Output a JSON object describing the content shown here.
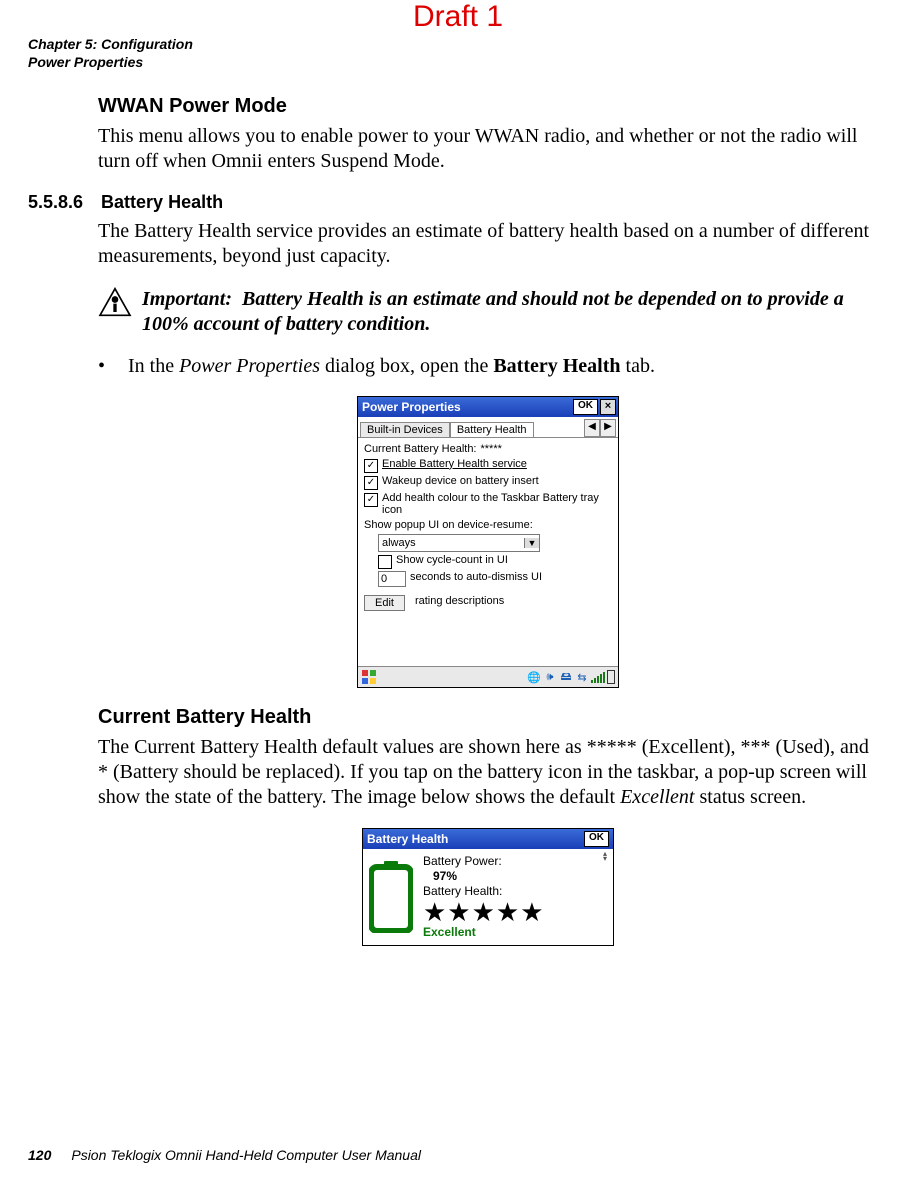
{
  "draft": "Draft 1",
  "header": {
    "chapter": "Chapter 5: Configuration",
    "section": "Power Properties"
  },
  "wwan": {
    "title": "WWAN Power Mode",
    "para": "This menu allows you to enable power to your WWAN radio, and whether or not the radio will turn off when Omnii enters Suspend Mode."
  },
  "battery_section": {
    "num": "5.5.8.6",
    "title": "Battery Health",
    "para": "The Battery Health service provides an estimate of battery health based on a number of different measurements, beyond just capacity."
  },
  "important": {
    "label": "Important:",
    "text": "Battery Health is an estimate and should not be depended on to provide a 100% account of battery condition."
  },
  "bullet": {
    "pre": "In the ",
    "italic": "Power Properties",
    "mid": " dialog box, open the ",
    "bold": "Battery Health",
    "post": " tab."
  },
  "power_window": {
    "title": "Power Properties",
    "ok": "OK",
    "close": "×",
    "tabs": {
      "inactive": "Built-in Devices",
      "active": "Battery Health",
      "left": "◀",
      "right": "▶"
    },
    "fields": {
      "current_label": "Current Battery Health: ",
      "current_value": "*****",
      "cb1": "Enable Battery Health service",
      "cb2": "Wakeup device on battery insert",
      "cb3": "Add health colour to the Taskbar Battery tray icon",
      "popup_label": "Show popup UI on device-resume:",
      "popup_value": "always",
      "cb4": "Show cycle-count in UI",
      "seconds_value": "0",
      "seconds_label": " seconds to auto-dismiss UI",
      "edit": "Edit",
      "edit_label": " rating descriptions"
    }
  },
  "cbh": {
    "title": "Current Battery Health",
    "p1a": "The Current Battery Health default values are shown here as ***** (Excellent), *** (Used), and * (Battery should be replaced). If you tap on the battery icon in the taskbar, a pop-up screen will show the state of the battery. The image below shows the default ",
    "p1i": "Excellent",
    "p1b": " status screen."
  },
  "bh_window": {
    "title": "Battery Health",
    "ok": "OK",
    "power_label": "Battery Power:",
    "power_value": "97%",
    "health_label": "Battery Health:",
    "stars": "★★★★★",
    "rating": "Excellent"
  },
  "footer": {
    "page": "120",
    "title": "Psion Teklogix Omnii Hand-Held Computer User Manual"
  }
}
